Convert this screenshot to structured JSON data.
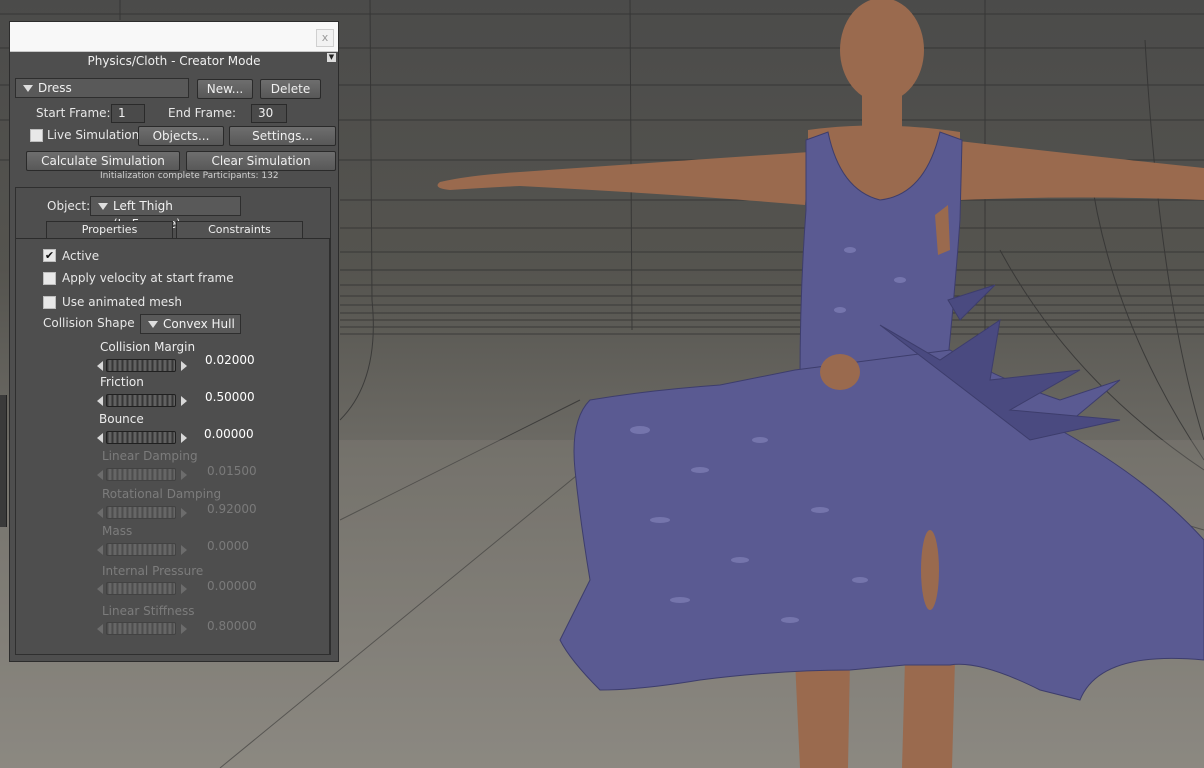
{
  "panel": {
    "title": "Physics/Cloth - Creator Mode",
    "close_glyph": "x",
    "cloth_selector": "Dress",
    "new_button": "New...",
    "delete_button": "Delete",
    "start_frame_label": "Start Frame:",
    "start_frame_value": "1",
    "end_frame_label": "End Frame:",
    "end_frame_value": "30",
    "live_simulation_label": "Live Simulation",
    "live_simulation_checked": false,
    "objects_button": "Objects...",
    "settings_button": "Settings...",
    "calculate_button": "Calculate Simulation",
    "clear_button": "Clear Simulation",
    "status_text": "Initialization complete  Participants: 132",
    "object_label": "Object:",
    "object_value": "Left Thigh (LaFemme)",
    "tabs": [
      {
        "label": "Properties",
        "active": true
      },
      {
        "label": "Constraints",
        "active": false
      }
    ],
    "checkboxes": [
      {
        "label": "Active",
        "checked": true
      },
      {
        "label": "Apply velocity at start frame",
        "checked": false
      },
      {
        "label": "Use animated mesh",
        "checked": false
      }
    ],
    "collision_shape_label": "Collision Shape",
    "collision_shape_value": "Convex Hull",
    "dials": [
      {
        "label": "Collision Margin",
        "value": "0.02000",
        "enabled": true
      },
      {
        "label": "Friction",
        "value": "0.50000",
        "enabled": true
      },
      {
        "label": "Bounce",
        "value": "0.00000",
        "enabled": true
      },
      {
        "label": "Linear Damping",
        "value": "0.01500",
        "enabled": false
      },
      {
        "label": "Rotational Damping",
        "value": "0.92000",
        "enabled": false
      },
      {
        "label": "Mass",
        "value": "0.0000",
        "enabled": false
      },
      {
        "label": "Internal Pressure",
        "value": "0.00000",
        "enabled": false
      },
      {
        "label": "Linear Stiffness",
        "value": "0.80000",
        "enabled": false
      }
    ]
  },
  "viewport": {
    "dress_color": "#5a5a92",
    "skin_color": "#9a6a4e",
    "floor_color": "#8a877f"
  }
}
